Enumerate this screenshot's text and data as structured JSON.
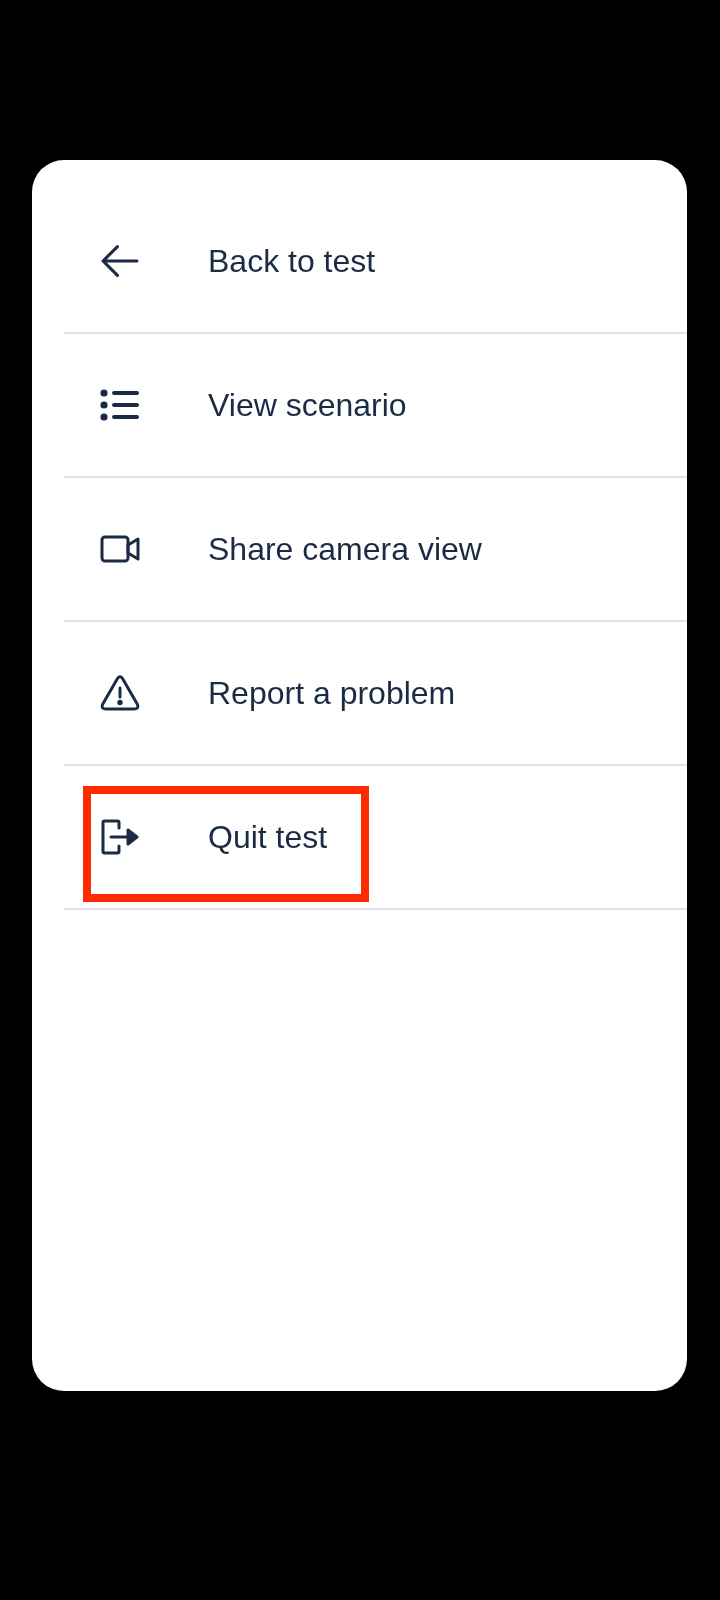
{
  "menu": {
    "items": [
      {
        "kind": "back",
        "label": "Back to test",
        "highlighted": false
      },
      {
        "kind": "list",
        "label": "View scenario",
        "highlighted": false
      },
      {
        "kind": "camera",
        "label": "Share camera view",
        "highlighted": false
      },
      {
        "kind": "warning",
        "label": "Report a problem",
        "highlighted": false
      },
      {
        "kind": "exit",
        "label": "Quit test",
        "highlighted": true
      }
    ]
  }
}
